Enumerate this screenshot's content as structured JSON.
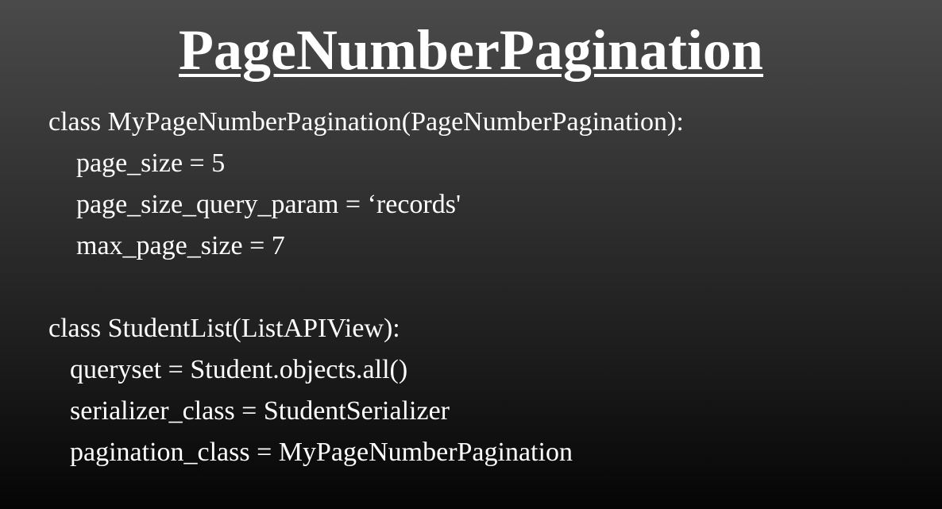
{
  "slide": {
    "title": "PageNumberPagination",
    "code_block_1": {
      "class_line": "class MyPageNumberPagination(PageNumberPagination):",
      "lines": [
        "page_size = 5",
        "page_size_query_param = ‘records'",
        "max_page_size = 7"
      ]
    },
    "code_block_2": {
      "class_line": "class StudentList(ListAPIView):",
      "lines": [
        "queryset = Student.objects.all()",
        "serializer_class = StudentSerializer",
        "pagination_class = MyPageNumberPagination"
      ]
    }
  }
}
